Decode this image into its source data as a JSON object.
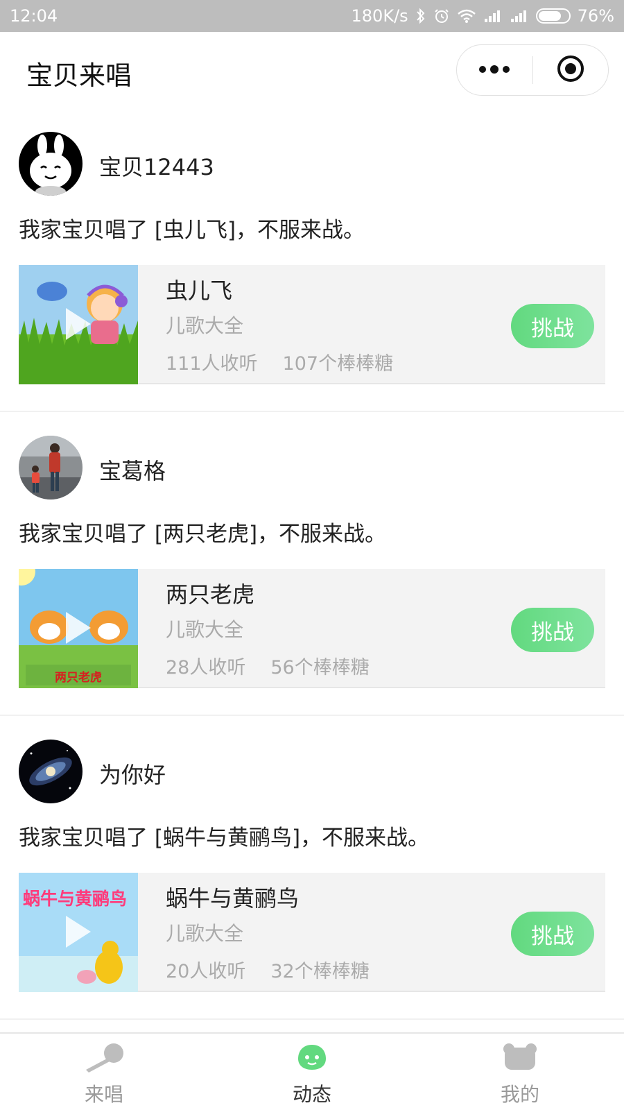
{
  "status_bar": {
    "time": "12:04",
    "network_speed": "180K/s",
    "battery_percent": "76%",
    "battery_level": 0.76,
    "icons": [
      "bluetooth-icon",
      "alarm-icon",
      "wifi-icon",
      "signal-icon",
      "signal-icon",
      "battery-icon"
    ]
  },
  "navbar": {
    "title": "宝贝来唱",
    "icons": [
      "more-icon",
      "close-miniprogram-icon"
    ]
  },
  "colors": {
    "accent_green": "#66dd84",
    "card_bg": "#f3f3f3",
    "muted_text": "#aaaaaa"
  },
  "posts": [
    {
      "username": "宝贝12443",
      "message": "我家宝贝唱了 [虫儿飞]，不服来战。",
      "song": {
        "title": "虫儿飞",
        "album": "儿歌大全",
        "listens": "111人收听",
        "candies": "107个棒棒糖"
      },
      "challenge_label": "挑战"
    },
    {
      "username": "宝葛格",
      "message": "我家宝贝唱了 [两只老虎]，不服来战。",
      "song": {
        "title": "两只老虎",
        "album": "儿歌大全",
        "listens": "28人收听",
        "candies": "56个棒棒糖",
        "thumb_caption": "两只老虎"
      },
      "challenge_label": "挑战"
    },
    {
      "username": "为你好",
      "message": "我家宝贝唱了 [蜗牛与黄鹂鸟]，不服来战。",
      "song": {
        "title": "蜗牛与黄鹂鸟",
        "album": "儿歌大全",
        "listens": "20人收听",
        "candies": "32个棒棒糖",
        "thumb_caption": "蜗牛与黄鹂鸟"
      },
      "challenge_label": "挑战"
    }
  ],
  "tabbar": {
    "tabs": [
      {
        "label": "来唱",
        "icon": "microphone-icon",
        "active": false
      },
      {
        "label": "动态",
        "icon": "feed-icon",
        "active": true
      },
      {
        "label": "我的",
        "icon": "profile-icon",
        "active": false
      }
    ]
  }
}
